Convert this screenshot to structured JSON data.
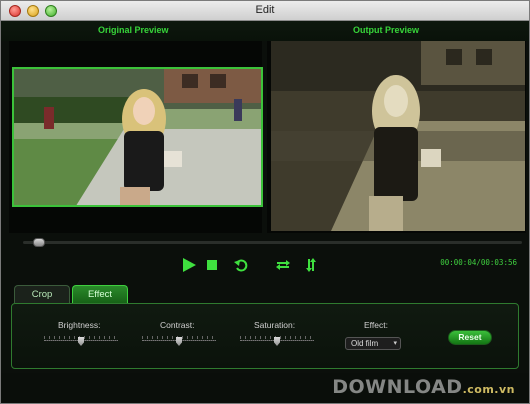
{
  "window": {
    "title": "Edit"
  },
  "preview": {
    "original_label": "Original Preview",
    "output_label": "Output Preview"
  },
  "playback": {
    "timecode": "00:00:04/00:03:56",
    "progress": 0.02
  },
  "tabs": [
    {
      "label": "Crop",
      "active": false
    },
    {
      "label": "Effect",
      "active": true
    }
  ],
  "effect_panel": {
    "brightness_label": "Brightness:",
    "brightness_value": 0.5,
    "contrast_label": "Contrast:",
    "contrast_value": 0.5,
    "saturation_label": "Saturation:",
    "saturation_value": 0.5,
    "effect_label": "Effect:",
    "effect_value": "Old film",
    "reset_label": "Reset"
  },
  "watermark": {
    "text": "DOWNLOAD",
    "suffix": ".com.vn"
  },
  "colors": {
    "accent": "#37d43a",
    "panel_bg": "#0b0f0b"
  }
}
